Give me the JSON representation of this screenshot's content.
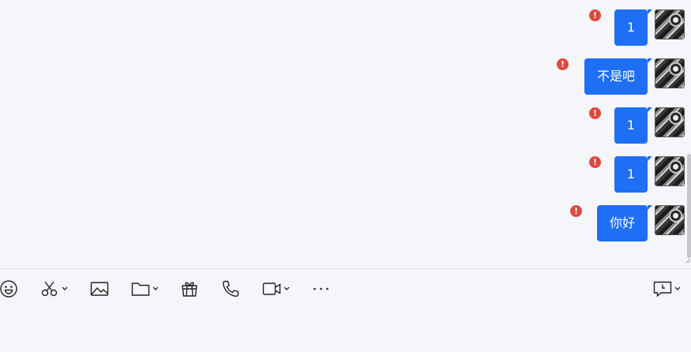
{
  "messages": [
    {
      "text": "1",
      "status": "failed",
      "status_symbol": "!"
    },
    {
      "text": "不是吧",
      "status": "failed",
      "status_symbol": "!"
    },
    {
      "text": "1",
      "status": "failed",
      "status_symbol": "!"
    },
    {
      "text": "1",
      "status": "failed",
      "status_symbol": "!"
    },
    {
      "text": "你好",
      "status": "failed",
      "status_symbol": "!"
    }
  ],
  "colors": {
    "bubble": "#1e6ff5",
    "bubble_text": "#ffffff",
    "error_badge": "#e0483e",
    "background": "#f5f6fa"
  },
  "toolbar": {
    "icons": [
      "emoji-icon",
      "scissors-icon",
      "image-icon",
      "folder-icon",
      "gift-icon",
      "phone-icon",
      "video-icon",
      "more-icon",
      "chat-history-icon"
    ],
    "dropdowns": [
      "scissors",
      "folder",
      "video",
      "chat-history"
    ]
  },
  "input": {
    "value": ""
  }
}
